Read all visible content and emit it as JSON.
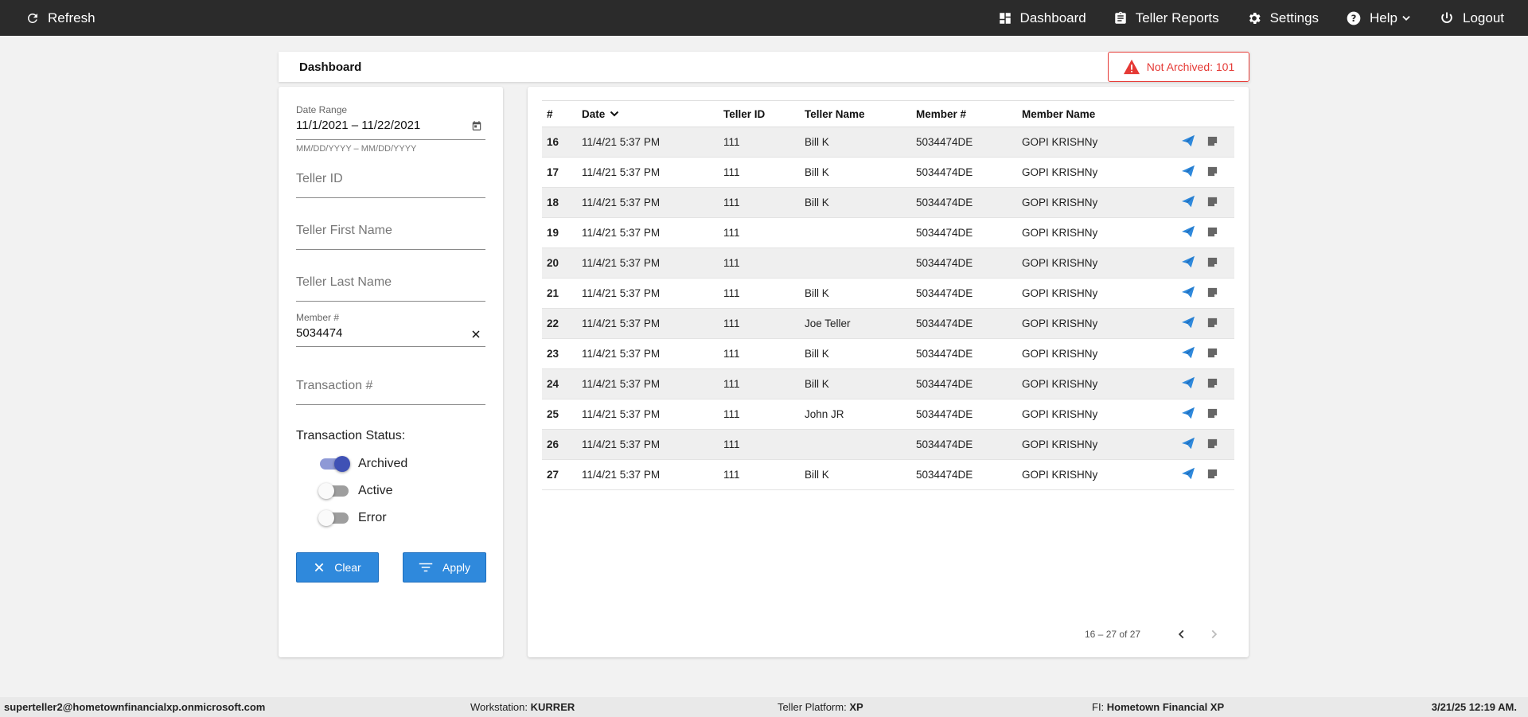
{
  "nav": {
    "refresh_label": "Refresh",
    "dashboard_label": "Dashboard",
    "teller_reports_label": "Teller Reports",
    "settings_label": "Settings",
    "help_label": "Help",
    "logout_label": "Logout"
  },
  "header": {
    "title": "Dashboard",
    "not_archived": "Not Archived: 101"
  },
  "filters": {
    "date_range_label": "Date Range",
    "date_range_value": "11/1/2021 – 11/22/2021",
    "date_range_hint": "MM/DD/YYYY – MM/DD/YYYY",
    "teller_id_placeholder": "Teller ID",
    "teller_first_placeholder": "Teller First Name",
    "teller_last_placeholder": "Teller Last Name",
    "member_label": "Member #",
    "member_value": "5034474",
    "transaction_placeholder": "Transaction #",
    "status_title": "Transaction Status:",
    "toggles": [
      {
        "label": "Archived",
        "on": true
      },
      {
        "label": "Active",
        "on": false
      },
      {
        "label": "Error",
        "on": false
      }
    ],
    "clear_label": "Clear",
    "apply_label": "Apply"
  },
  "table": {
    "headers": [
      "#",
      "Date",
      "Teller ID",
      "Teller Name",
      "Member #",
      "Member Name"
    ],
    "rows": [
      {
        "num": "16",
        "date": "11/4/21 5:37 PM",
        "teller_id": "111",
        "teller_name": "Bill K",
        "member": "5034474DE",
        "member_name": "GOPI KRISHNy"
      },
      {
        "num": "17",
        "date": "11/4/21 5:37 PM",
        "teller_id": "111",
        "teller_name": "Bill K",
        "member": "5034474DE",
        "member_name": "GOPI KRISHNy"
      },
      {
        "num": "18",
        "date": "11/4/21 5:37 PM",
        "teller_id": "111",
        "teller_name": "Bill K",
        "member": "5034474DE",
        "member_name": "GOPI KRISHNy"
      },
      {
        "num": "19",
        "date": "11/4/21 5:37 PM",
        "teller_id": "111",
        "teller_name": "",
        "member": "5034474DE",
        "member_name": "GOPI KRISHNy"
      },
      {
        "num": "20",
        "date": "11/4/21 5:37 PM",
        "teller_id": "111",
        "teller_name": "",
        "member": "5034474DE",
        "member_name": "GOPI KRISHNy"
      },
      {
        "num": "21",
        "date": "11/4/21 5:37 PM",
        "teller_id": "111",
        "teller_name": "Bill K",
        "member": "5034474DE",
        "member_name": "GOPI KRISHNy"
      },
      {
        "num": "22",
        "date": "11/4/21 5:37 PM",
        "teller_id": "111",
        "teller_name": "Joe Teller",
        "member": "5034474DE",
        "member_name": "GOPI KRISHNy"
      },
      {
        "num": "23",
        "date": "11/4/21 5:37 PM",
        "teller_id": "111",
        "teller_name": "Bill K",
        "member": "5034474DE",
        "member_name": "GOPI KRISHNy"
      },
      {
        "num": "24",
        "date": "11/4/21 5:37 PM",
        "teller_id": "111",
        "teller_name": "Bill K",
        "member": "5034474DE",
        "member_name": "GOPI KRISHNy"
      },
      {
        "num": "25",
        "date": "11/4/21 5:37 PM",
        "teller_id": "111",
        "teller_name": "John JR",
        "member": "5034474DE",
        "member_name": "GOPI KRISHNy"
      },
      {
        "num": "26",
        "date": "11/4/21 5:37 PM",
        "teller_id": "111",
        "teller_name": "",
        "member": "5034474DE",
        "member_name": "GOPI KRISHNy"
      },
      {
        "num": "27",
        "date": "11/4/21 5:37 PM",
        "teller_id": "111",
        "teller_name": "Bill K",
        "member": "5034474DE",
        "member_name": "GOPI KRISHNy"
      }
    ],
    "pagination": "16 – 27 of 27"
  },
  "footer": {
    "user": "superteller2@hometownfinancialxp.onmicrosoft.com",
    "workstation_label": "Workstation:",
    "workstation_value": "KURRER",
    "platform_label": "Teller Platform:",
    "platform_value": "XP",
    "fi_label": "FI:",
    "fi_value": "Hometown Financial XP",
    "datetime": "3/21/25 12:19 AM."
  },
  "colors": {
    "accent": "#2f89dc",
    "alert": "#e53935",
    "toggle_on": "#3f51b5",
    "topbar": "#2b2b2b"
  }
}
